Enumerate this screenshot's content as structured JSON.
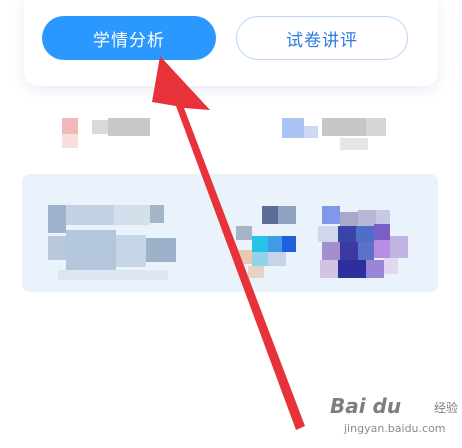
{
  "tabs": {
    "primary_label": "学情分析",
    "secondary_label": "试卷讲评"
  },
  "colors": {
    "primary": "#2b98ff",
    "secondary_text": "#2b7de0",
    "arrow": "#e8323a",
    "card_background": "#eaf3fc"
  },
  "watermark": {
    "logo": "Bai du",
    "subtitle": "经验",
    "url": "jingyan.baidu.com"
  },
  "annotation": {
    "icon": "red-arrow-pointer"
  }
}
